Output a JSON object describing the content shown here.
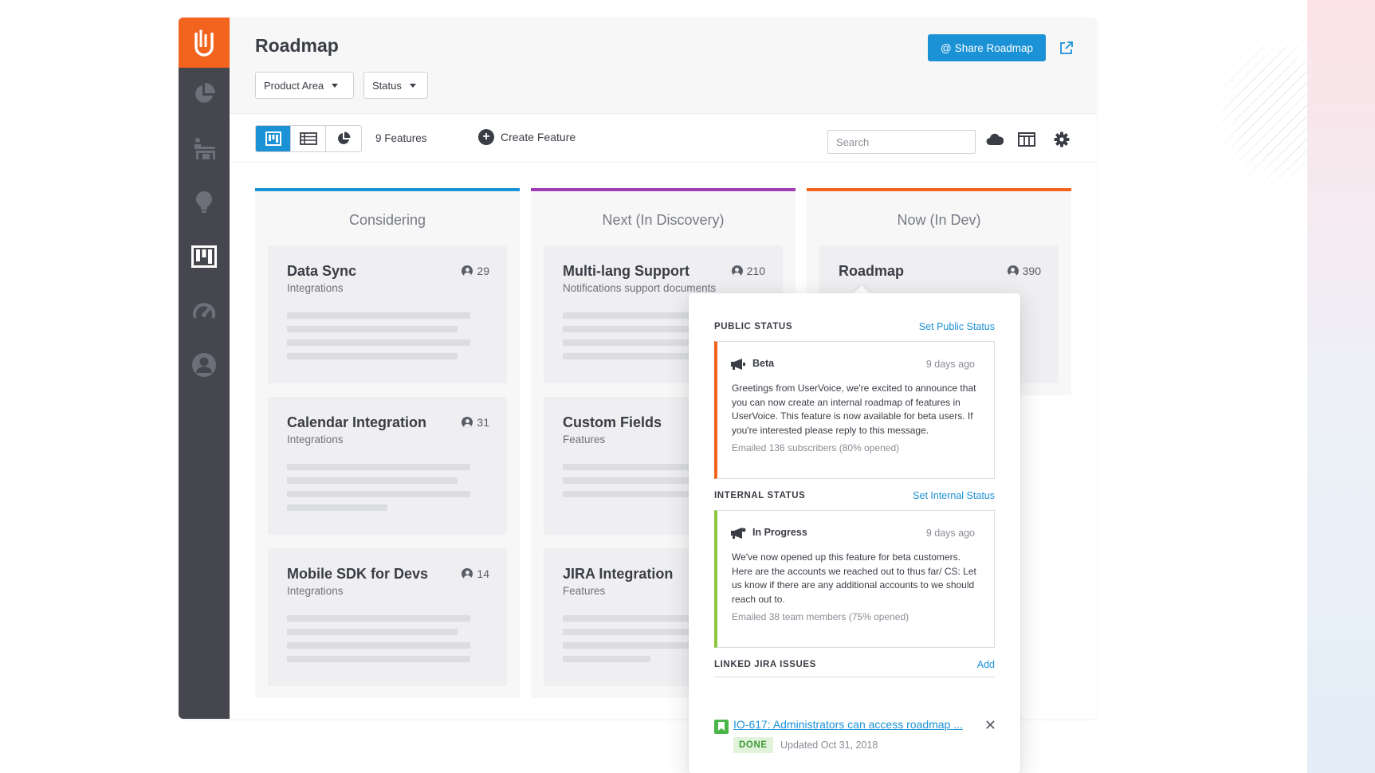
{
  "app": {
    "page_title": "Roadmap",
    "share_button": "Share Roadmap",
    "share_at": "@"
  },
  "filters": [
    {
      "label": "Product Area"
    },
    {
      "label": "Status"
    }
  ],
  "toolbar": {
    "feature_count": "9 Features",
    "create_feature": "Create Feature",
    "search_placeholder": "Search"
  },
  "sidebar": {
    "items": [
      {
        "icon": "pie-chart-icon"
      },
      {
        "icon": "storefront-icon"
      },
      {
        "icon": "lightbulb-icon"
      },
      {
        "icon": "roadmap-board-icon",
        "active": true
      },
      {
        "icon": "gauge-icon"
      },
      {
        "icon": "user-circle-icon"
      }
    ]
  },
  "columns": [
    {
      "title": "Considering",
      "color": "#1b91d6",
      "cards": [
        {
          "title": "Data Sync",
          "subtitle": "Integrations",
          "votes": "29"
        },
        {
          "title": "Calendar Integration",
          "subtitle": "Integrations",
          "votes": "31"
        },
        {
          "title": "Mobile SDK for Devs",
          "subtitle": "Integrations",
          "votes": "14"
        }
      ]
    },
    {
      "title": "Next (In Discovery)",
      "color": "#a23bb6",
      "cards": [
        {
          "title": "Multi-lang Support",
          "subtitle": "Notifications support documents",
          "votes": "210"
        },
        {
          "title": "Custom Fields",
          "subtitle": "Features",
          "votes": ""
        },
        {
          "title": "JIRA Integration",
          "subtitle": "Features",
          "votes": ""
        }
      ]
    },
    {
      "title": "Now (In Dev)",
      "color": "#f2641d",
      "cards": [
        {
          "title": "Roadmap",
          "subtitle": "",
          "votes": "390"
        }
      ]
    }
  ],
  "popover": {
    "public_status": {
      "heading": "PUBLIC STATUS",
      "action": "Set Public Status",
      "label": "Beta",
      "time": "9 days ago",
      "body": "Greetings from UserVoice, we're excited to announce that you can now create an internal roadmap of features in UserVoice. This feature is now available for beta users. If you're interested please reply to this message.",
      "footer": "Emailed 136 subscribers (80% opened)",
      "color": "#f2641d"
    },
    "internal_status": {
      "heading": "INTERNAL STATUS",
      "action": "Set Internal Status",
      "label": "In Progress",
      "time": "9 days ago",
      "body": "We've now opened up this feature for beta customers. Here are the accounts we reached out to thus far/ CS: Let us know if there are any additional accounts to we should reach out to.",
      "footer": "Emailed 38 team members (75% opened)",
      "color": "#8cc63f"
    },
    "jira": {
      "heading": "LINKED JIRA ISSUES",
      "action": "Add",
      "issue": "IO-617: Administrators can access roadmap ...",
      "status": "DONE",
      "updated": "Updated Oct 31, 2018"
    }
  }
}
